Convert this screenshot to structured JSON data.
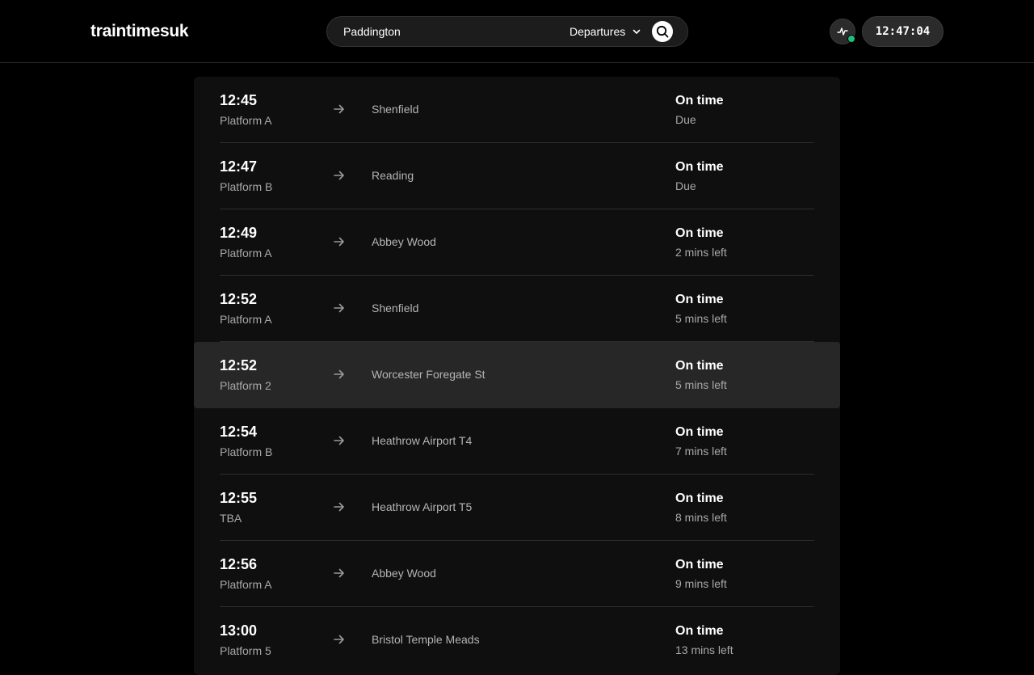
{
  "header": {
    "brand": "traintimesuk",
    "search": {
      "value": "Paddington",
      "placeholder": ""
    },
    "mode": "Departures",
    "clock": "12:47:04",
    "icons": {
      "mode": "chevron-down-icon",
      "search": "search-icon",
      "activity": "activity-icon"
    },
    "status_color": "#1fbf7a"
  },
  "departures": [
    {
      "time": "12:45",
      "platform": "Platform A",
      "destination": "Shenfield",
      "status": "On time",
      "eta": "Due"
    },
    {
      "time": "12:47",
      "platform": "Platform B",
      "destination": "Reading",
      "status": "On time",
      "eta": "Due"
    },
    {
      "time": "12:49",
      "platform": "Platform A",
      "destination": "Abbey Wood",
      "status": "On time",
      "eta": "2 mins left"
    },
    {
      "time": "12:52",
      "platform": "Platform A",
      "destination": "Shenfield",
      "status": "On time",
      "eta": "5 mins left"
    },
    {
      "time": "12:52",
      "platform": "Platform 2",
      "destination": "Worcester Foregate St",
      "status": "On time",
      "eta": "5 mins left"
    },
    {
      "time": "12:54",
      "platform": "Platform B",
      "destination": "Heathrow Airport T4",
      "status": "On time",
      "eta": "7 mins left"
    },
    {
      "time": "12:55",
      "platform": "TBA",
      "destination": "Heathrow Airport T5",
      "status": "On time",
      "eta": "8 mins left"
    },
    {
      "time": "12:56",
      "platform": "Platform A",
      "destination": "Abbey Wood",
      "status": "On time",
      "eta": "9 mins left"
    },
    {
      "time": "13:00",
      "platform": "Platform 5",
      "destination": "Bristol Temple Meads",
      "status": "On time",
      "eta": "13 mins left"
    }
  ]
}
